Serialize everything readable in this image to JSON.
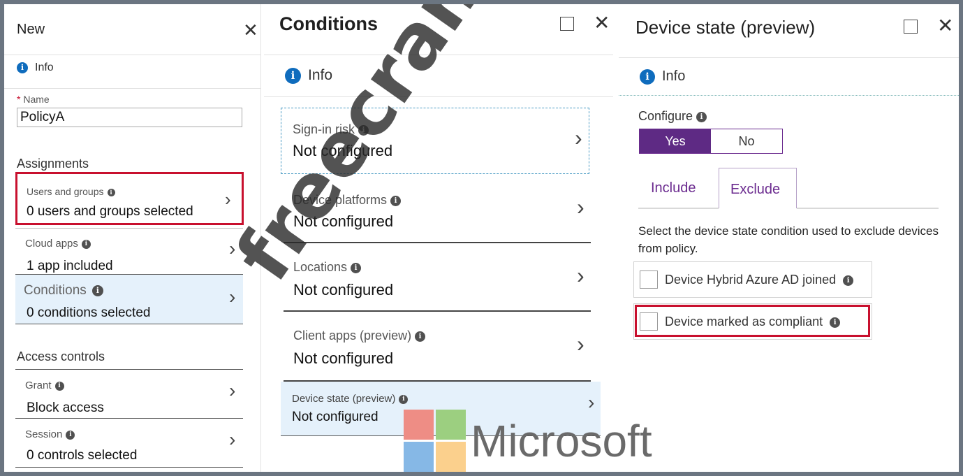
{
  "blade_new": {
    "title": "New",
    "info": "Info",
    "name_required": "*",
    "name_label": "Name",
    "name_value": "PolicyA",
    "assignments_heading": "Assignments",
    "users_groups": {
      "label": "Users and groups",
      "value": "0 users and groups selected"
    },
    "cloud_apps": {
      "label": "Cloud apps",
      "value": "1 app included"
    },
    "conditions": {
      "label": "Conditions",
      "value": "0 conditions selected"
    },
    "access_controls_heading": "Access controls",
    "grant": {
      "label": "Grant",
      "value": "Block access"
    },
    "session": {
      "label": "Session",
      "value": "0 controls selected"
    }
  },
  "blade_conditions": {
    "title": "Conditions",
    "info": "Info",
    "items": [
      {
        "label": "Sign-in risk",
        "value": "Not configured"
      },
      {
        "label": "Device platforms",
        "value": "Not configured"
      },
      {
        "label": "Locations",
        "value": "Not configured"
      },
      {
        "label": "Client apps (preview)",
        "value": "Not configured"
      },
      {
        "label": "Device state (preview)",
        "value": "Not configured"
      }
    ]
  },
  "blade_device_state": {
    "title": "Device state (preview)",
    "info": "Info",
    "configure_label": "Configure",
    "yes": "Yes",
    "no": "No",
    "tab_include": "Include",
    "tab_exclude": "Exclude",
    "description": "Select the device state condition used to exclude devices from policy.",
    "option_hybrid": "Device Hybrid Azure AD joined",
    "option_compliant": "Device marked as compliant"
  },
  "branding": {
    "microsoft": "Microsoft",
    "watermark": "freecram.net"
  },
  "icons": {
    "info": "info-icon",
    "close": "close-icon",
    "maximize": "maximize-icon",
    "chevron": "chevron-right-icon"
  },
  "colors": {
    "accent_purple": "#6b2b8f",
    "selected_row": "#e5f1fb",
    "highlight_red": "#c8102e",
    "info_blue": "#0f6cbd"
  }
}
